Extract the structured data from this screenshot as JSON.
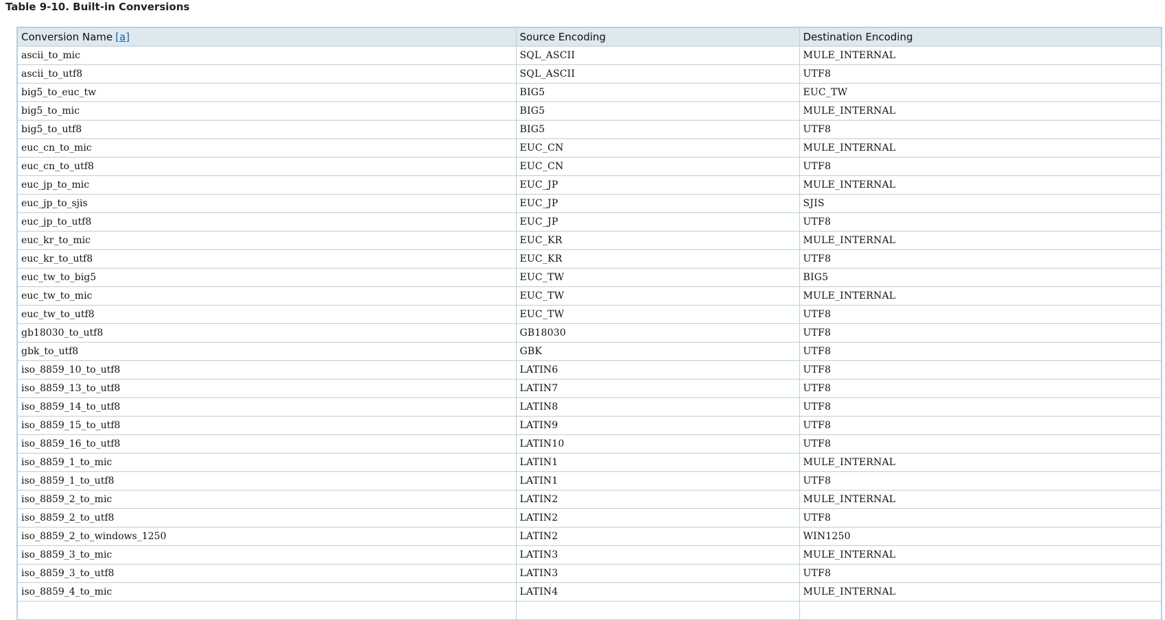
{
  "caption": "Table 9-10. Built-in Conversions",
  "table": {
    "headers": {
      "name": "Conversion Name",
      "footnote": "[a]",
      "source": "Source Encoding",
      "destination": "Destination Encoding"
    },
    "rows": [
      [
        "ascii_to_mic",
        "SQL_ASCII",
        "MULE_INTERNAL"
      ],
      [
        "ascii_to_utf8",
        "SQL_ASCII",
        "UTF8"
      ],
      [
        "big5_to_euc_tw",
        "BIG5",
        "EUC_TW"
      ],
      [
        "big5_to_mic",
        "BIG5",
        "MULE_INTERNAL"
      ],
      [
        "big5_to_utf8",
        "BIG5",
        "UTF8"
      ],
      [
        "euc_cn_to_mic",
        "EUC_CN",
        "MULE_INTERNAL"
      ],
      [
        "euc_cn_to_utf8",
        "EUC_CN",
        "UTF8"
      ],
      [
        "euc_jp_to_mic",
        "EUC_JP",
        "MULE_INTERNAL"
      ],
      [
        "euc_jp_to_sjis",
        "EUC_JP",
        "SJIS"
      ],
      [
        "euc_jp_to_utf8",
        "EUC_JP",
        "UTF8"
      ],
      [
        "euc_kr_to_mic",
        "EUC_KR",
        "MULE_INTERNAL"
      ],
      [
        "euc_kr_to_utf8",
        "EUC_KR",
        "UTF8"
      ],
      [
        "euc_tw_to_big5",
        "EUC_TW",
        "BIG5"
      ],
      [
        "euc_tw_to_mic",
        "EUC_TW",
        "MULE_INTERNAL"
      ],
      [
        "euc_tw_to_utf8",
        "EUC_TW",
        "UTF8"
      ],
      [
        "gb18030_to_utf8",
        "GB18030",
        "UTF8"
      ],
      [
        "gbk_to_utf8",
        "GBK",
        "UTF8"
      ],
      [
        "iso_8859_10_to_utf8",
        "LATIN6",
        "UTF8"
      ],
      [
        "iso_8859_13_to_utf8",
        "LATIN7",
        "UTF8"
      ],
      [
        "iso_8859_14_to_utf8",
        "LATIN8",
        "UTF8"
      ],
      [
        "iso_8859_15_to_utf8",
        "LATIN9",
        "UTF8"
      ],
      [
        "iso_8859_16_to_utf8",
        "LATIN10",
        "UTF8"
      ],
      [
        "iso_8859_1_to_mic",
        "LATIN1",
        "MULE_INTERNAL"
      ],
      [
        "iso_8859_1_to_utf8",
        "LATIN1",
        "UTF8"
      ],
      [
        "iso_8859_2_to_mic",
        "LATIN2",
        "MULE_INTERNAL"
      ],
      [
        "iso_8859_2_to_utf8",
        "LATIN2",
        "UTF8"
      ],
      [
        "iso_8859_2_to_windows_1250",
        "LATIN2",
        "WIN1250"
      ],
      [
        "iso_8859_3_to_mic",
        "LATIN3",
        "MULE_INTERNAL"
      ],
      [
        "iso_8859_3_to_utf8",
        "LATIN3",
        "UTF8"
      ],
      [
        "iso_8859_4_to_mic",
        "LATIN4",
        "MULE_INTERNAL"
      ],
      [
        "",
        "",
        ""
      ]
    ]
  }
}
